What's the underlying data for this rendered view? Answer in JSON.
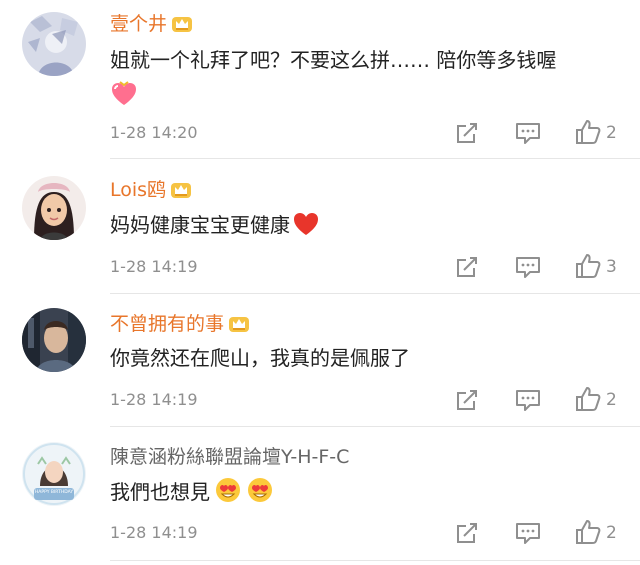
{
  "accent_colors": {
    "username_vip": "#e8762b",
    "username_normal": "#666666",
    "meta_text": "#8f8f8f"
  },
  "comments": [
    {
      "username": "壹个井",
      "content": "姐就一个礼拜了吧？不要这么拼…… 陪你等多钱喔",
      "emoji": "heart-gift-emoji",
      "time": "1-28 14:20",
      "likes": "2",
      "vip_badge": "crown-badge-icon"
    },
    {
      "username": "Lois鸥",
      "content": "妈妈健康宝宝更健康",
      "emoji": "red-heart-emoji",
      "time": "1-28 14:19",
      "likes": "3",
      "vip_badge": "crown-badge-icon"
    },
    {
      "username": "不曾拥有的事",
      "content": "你竟然还在爬山，我真的是佩服了",
      "time": "1-28 14:19",
      "likes": "2",
      "vip_badge": "crown-badge-icon"
    },
    {
      "username": "陳意涵粉絲聯盟論壇Y-H-F-C",
      "content": "我們也想見",
      "emoji": "heart-eyes-emoji",
      "time": "1-28 14:19",
      "likes": "2",
      "avatar_text": "HAPPY BIRTHDAY"
    }
  ]
}
